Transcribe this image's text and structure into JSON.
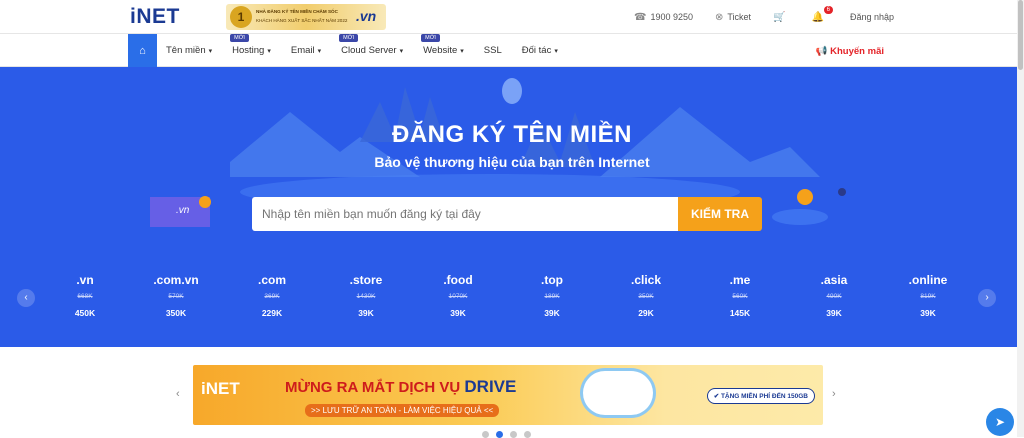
{
  "header": {
    "logo": "iNET",
    "award_line1": "NHÀ ĐĂNG KÝ TÊN MIỀN CHĂM SÓC",
    "award_line2": "KHÁCH HÀNG XUẤT SẮC NHẤT NĂM 2022",
    "award_badge": "1",
    "award_domain": ".vn",
    "phone": "1900 9250",
    "ticket": "Ticket",
    "notif_count": "6",
    "login": "Đăng nhập"
  },
  "nav": {
    "items": [
      {
        "label": "Tên miền",
        "new": ""
      },
      {
        "label": "Hosting",
        "new": "MỚI"
      },
      {
        "label": "Email",
        "new": ""
      },
      {
        "label": "Cloud Server",
        "new": "MỚI"
      },
      {
        "label": "Website",
        "new": "MỚI"
      },
      {
        "label": "SSL",
        "new": ""
      },
      {
        "label": "Đối tác",
        "new": ""
      }
    ],
    "promo": "Khuyến mãi"
  },
  "hero": {
    "title": "ĐĂNG KÝ TÊN MIỀN",
    "subtitle": "Bảo vệ thương hiệu của bạn trên Internet",
    "illustration_tag": ".vn",
    "search_placeholder": "Nhập tên miền bạn muốn đăng ký tại đây",
    "search_button": "KIỂM TRA"
  },
  "tlds": [
    {
      "name": ".vn",
      "old": "668K",
      "new": "450K"
    },
    {
      "name": ".com.vn",
      "old": "570K",
      "new": "350K"
    },
    {
      "name": ".com",
      "old": "369K",
      "new": "229K"
    },
    {
      "name": ".store",
      "old": "1430K",
      "new": "39K"
    },
    {
      "name": ".food",
      "old": "1070K",
      "new": "39K"
    },
    {
      "name": ".top",
      "old": "189K",
      "new": "39K"
    },
    {
      "name": ".click",
      "old": "350K",
      "new": "29K"
    },
    {
      "name": ".me",
      "old": "560K",
      "new": "145K"
    },
    {
      "name": ".asia",
      "old": "490K",
      "new": "39K"
    },
    {
      "name": ".online",
      "old": "819K",
      "new": "39K"
    }
  ],
  "banner": {
    "logo": "iNET",
    "heading": "MỪNG RA MẮT DỊCH VỤ",
    "heading_highlight": "DRIVE",
    "subline": ">> LƯU TRỮ AN TOÀN - LÀM VIỆC HIỆU QUẢ <<",
    "cta": "TẶNG MIỄN PHÍ ĐẾN 150GB"
  },
  "colors": {
    "brand_blue": "#2b5be8",
    "accent_orange": "#f5a11a",
    "promo_red": "#e42328"
  }
}
